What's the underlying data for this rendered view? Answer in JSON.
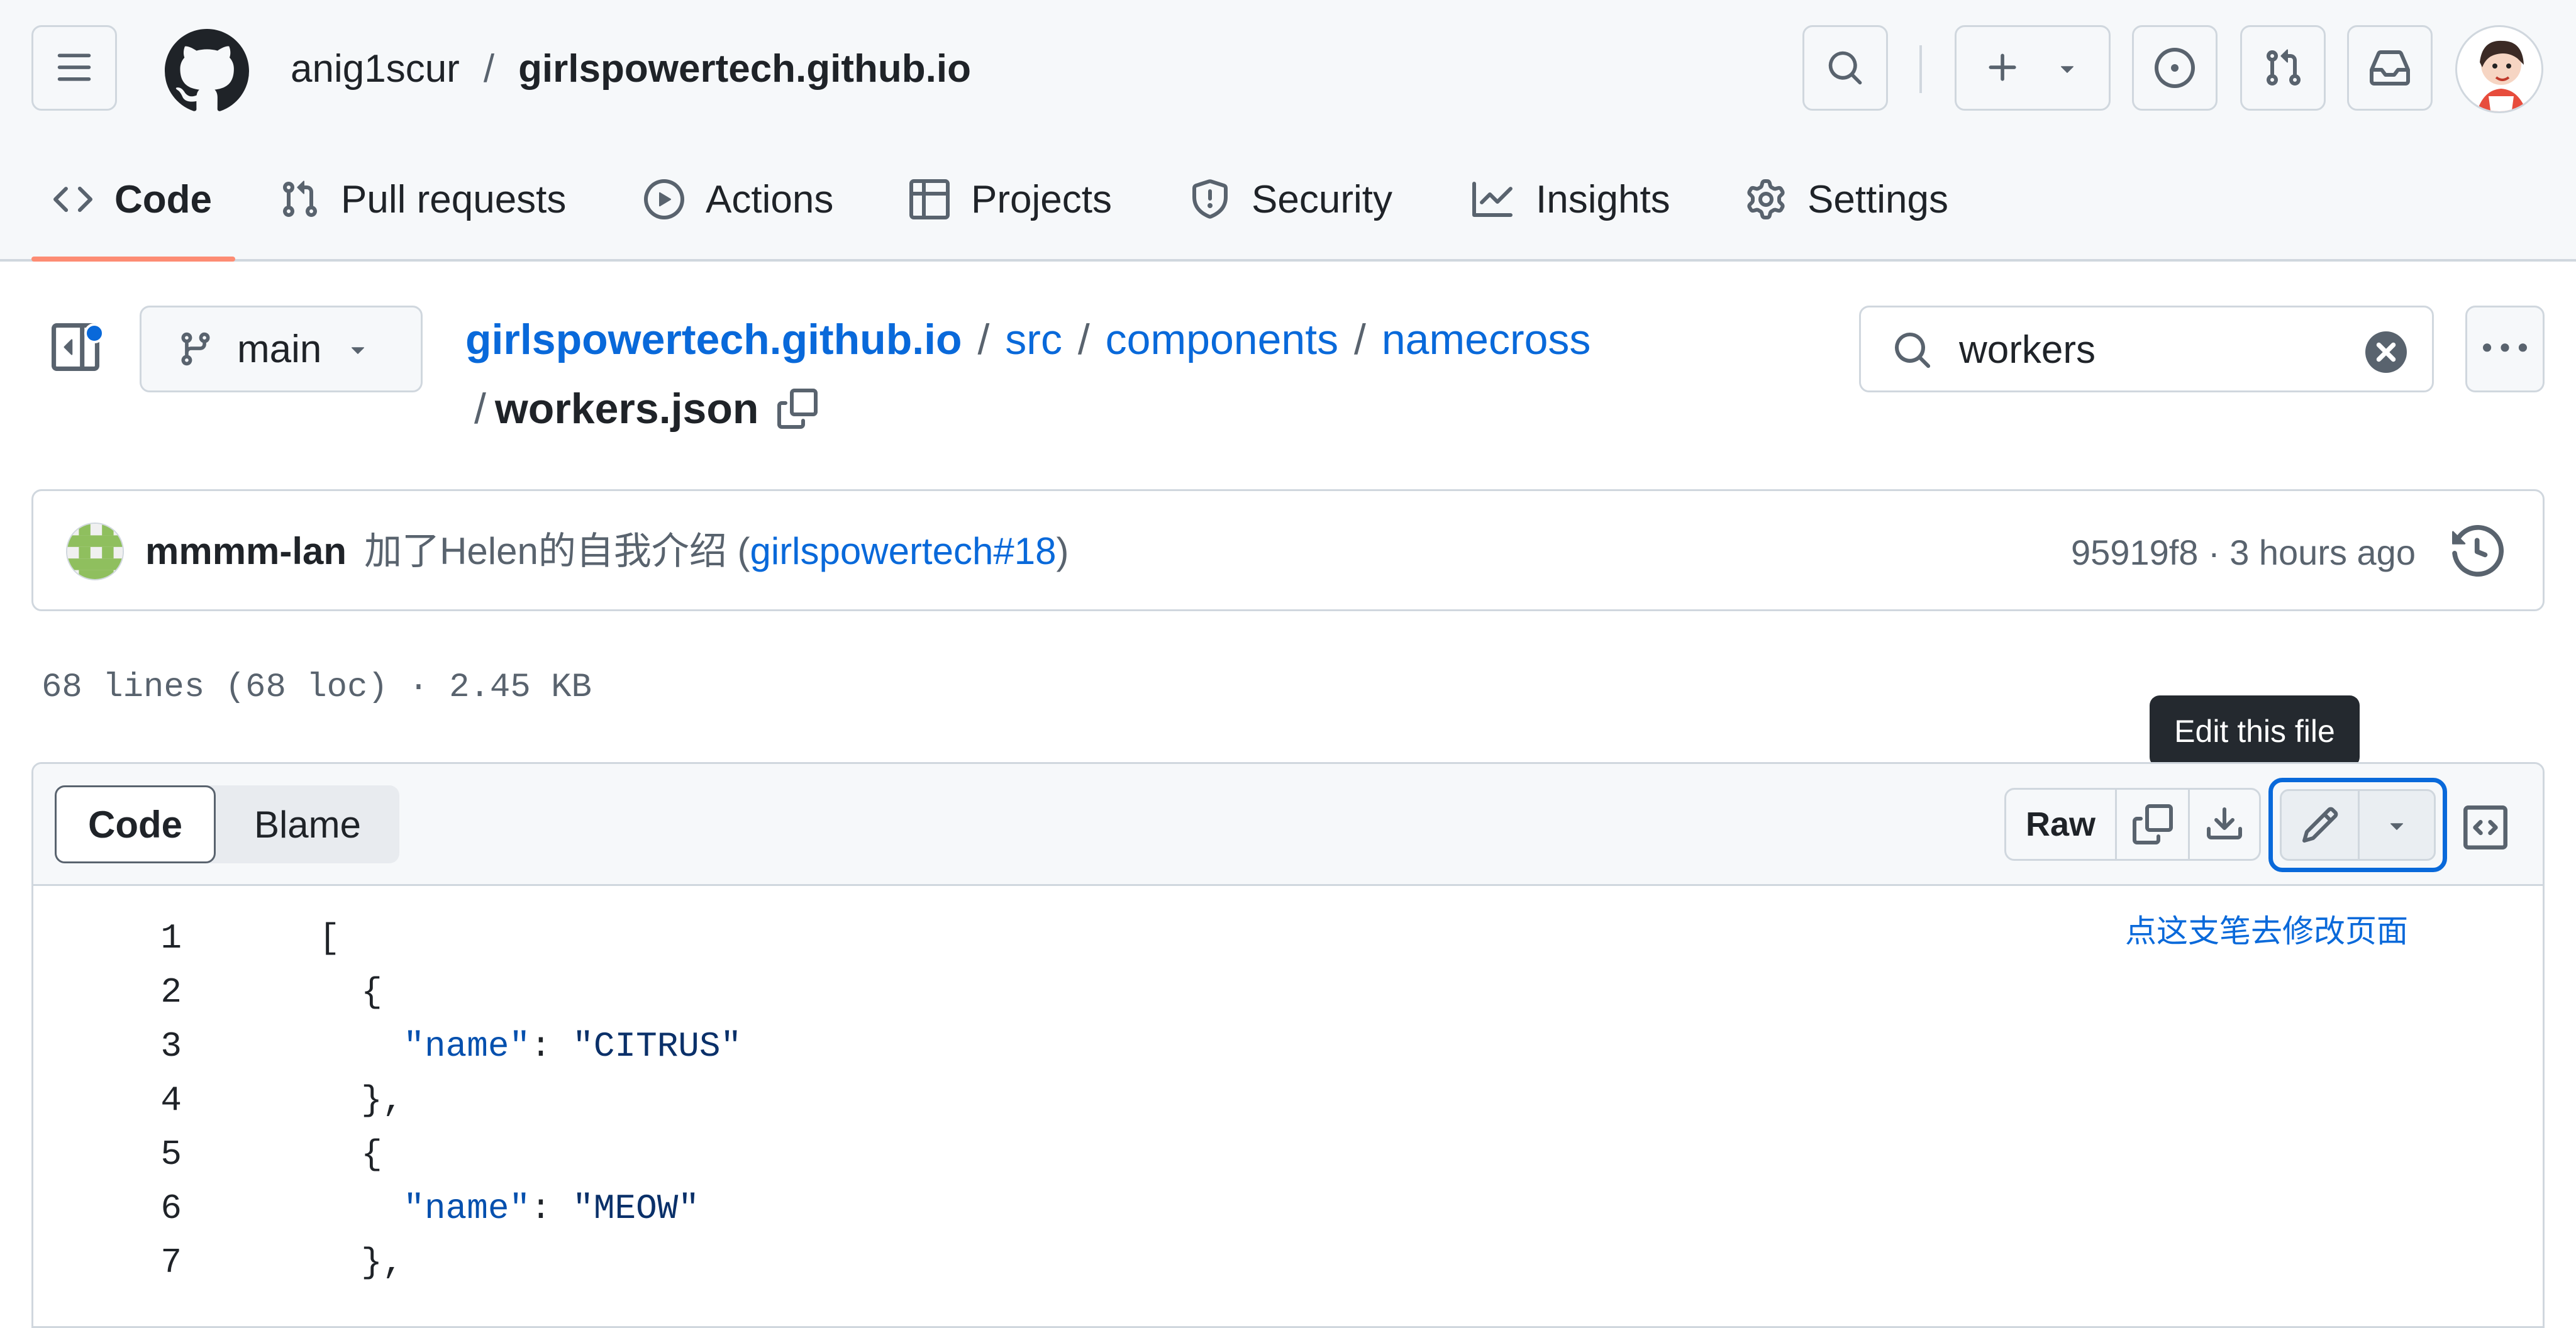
{
  "header": {
    "owner": "anig1scur",
    "separator": "/",
    "repo": "girlspowertech.github.io"
  },
  "tabs": [
    {
      "label": "Code",
      "icon": "code-icon"
    },
    {
      "label": "Pull requests",
      "icon": "git-pull-request-icon"
    },
    {
      "label": "Actions",
      "icon": "play-icon"
    },
    {
      "label": "Projects",
      "icon": "table-icon"
    },
    {
      "label": "Security",
      "icon": "shield-icon"
    },
    {
      "label": "Insights",
      "icon": "graph-icon"
    },
    {
      "label": "Settings",
      "icon": "gear-icon"
    }
  ],
  "branch": {
    "name": "main"
  },
  "breadcrumb": {
    "repo": "girlspowertech.github.io",
    "sep": "/",
    "path1": "src",
    "path2": "components",
    "path3": "namecross",
    "file": "workers.json"
  },
  "search": {
    "value": "workers"
  },
  "commit": {
    "author": "mmmm-lan",
    "message": "加了Helen的自我介绍 (",
    "pr_link": "girlspowertech#18",
    "message_end": ")",
    "sha_time": "95919f8 · 3 hours ago"
  },
  "file_info": "68 lines (68 loc) · 2.45 KB",
  "viewer": {
    "code_tab": "Code",
    "blame_tab": "Blame",
    "raw": "Raw",
    "tooltip": "Edit this file",
    "annotation": "点这支笔去修改页面"
  },
  "code_lines": [
    {
      "n": "1",
      "pre": "[",
      "key": "",
      "mid": "",
      "str": "",
      "post": ""
    },
    {
      "n": "2",
      "pre": "  {",
      "key": "",
      "mid": "",
      "str": "",
      "post": ""
    },
    {
      "n": "3",
      "pre": "    ",
      "key": "\"name\"",
      "mid": ": ",
      "str": "\"CITRUS\"",
      "post": ""
    },
    {
      "n": "4",
      "pre": "  },",
      "key": "",
      "mid": "",
      "str": "",
      "post": ""
    },
    {
      "n": "5",
      "pre": "  {",
      "key": "",
      "mid": "",
      "str": "",
      "post": ""
    },
    {
      "n": "6",
      "pre": "    ",
      "key": "\"name\"",
      "mid": ": ",
      "str": "\"MEOW\"",
      "post": ""
    },
    {
      "n": "7",
      "pre": "  },",
      "key": "",
      "mid": "",
      "str": "",
      "post": ""
    }
  ],
  "colors": {
    "accent_blue": "#0969da",
    "tab_underline": "#fd8c73",
    "tooltip_bg": "#24292f",
    "focus_ring": "#0969da"
  }
}
